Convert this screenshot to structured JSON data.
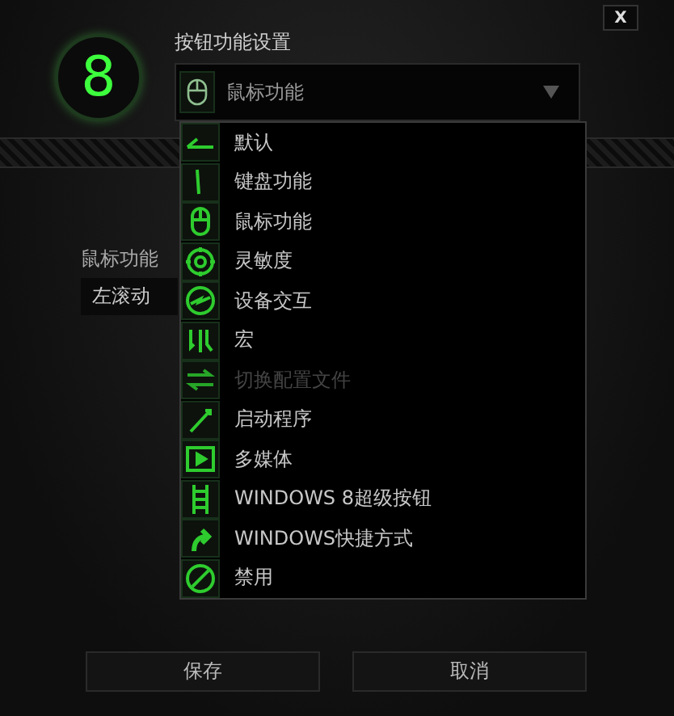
{
  "close_button": "X",
  "key_number": "8",
  "function_setting": {
    "label": "按钮功能设置",
    "value": "鼠标功能"
  },
  "menu_items": [
    {
      "label": "默认",
      "disabled": false
    },
    {
      "label": "键盘功能",
      "disabled": false
    },
    {
      "label": "鼠标功能",
      "disabled": false
    },
    {
      "label": "灵敏度",
      "disabled": false
    },
    {
      "label": "设备交互",
      "disabled": false
    },
    {
      "label": "宏",
      "disabled": false
    },
    {
      "label": "切换配置文件",
      "disabled": true
    },
    {
      "label": "启动程序",
      "disabled": false
    },
    {
      "label": "多媒体",
      "disabled": false
    },
    {
      "label": "WINDOWS 8超级按钮",
      "disabled": false
    },
    {
      "label": "WINDOWS快捷方式",
      "disabled": false
    },
    {
      "label": "禁用",
      "disabled": false
    }
  ],
  "mouse_function": {
    "label": "鼠标功能",
    "value": "左滚动"
  },
  "buttons": [
    "保存",
    "取消"
  ]
}
